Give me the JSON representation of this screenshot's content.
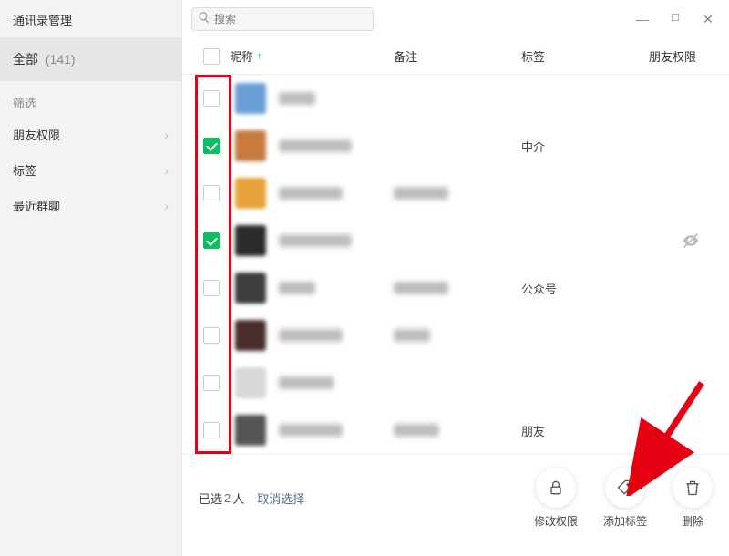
{
  "sidebar": {
    "title": "通讯录管理",
    "all_label": "全部",
    "all_count": "(141)",
    "filter_label": "筛选",
    "items": [
      {
        "label": "朋友权限"
      },
      {
        "label": "标签"
      },
      {
        "label": "最近群聊"
      }
    ]
  },
  "search": {
    "placeholder": "搜索"
  },
  "columns": {
    "nickname": "昵称",
    "remark": "备注",
    "tag": "标签",
    "permission": "朋友权限"
  },
  "rows": [
    {
      "checked": false,
      "avatar_color": "#6aa0d8",
      "nick_w": 40,
      "remark_w": 0,
      "tag": "",
      "perm_icon": false
    },
    {
      "checked": true,
      "avatar_color": "#c97a3f",
      "nick_w": 80,
      "remark_w": 0,
      "tag": "中介",
      "perm_icon": false
    },
    {
      "checked": false,
      "avatar_color": "#e8a23a",
      "nick_w": 70,
      "remark_w": 60,
      "tag": "",
      "perm_icon": false
    },
    {
      "checked": true,
      "avatar_color": "#2b2b2b",
      "nick_w": 80,
      "remark_w": 0,
      "tag": "",
      "perm_icon": true
    },
    {
      "checked": false,
      "avatar_color": "#3d3d3d",
      "nick_w": 40,
      "remark_w": 60,
      "tag": "公众号",
      "perm_icon": false
    },
    {
      "checked": false,
      "avatar_color": "#4a2d2d",
      "nick_w": 70,
      "remark_w": 40,
      "tag": "",
      "perm_icon": false
    },
    {
      "checked": false,
      "avatar_color": "#d8d8d8",
      "nick_w": 60,
      "remark_w": 0,
      "tag": "",
      "perm_icon": false
    },
    {
      "checked": false,
      "avatar_color": "#555555",
      "nick_w": 70,
      "remark_w": 50,
      "tag": "朋友",
      "perm_icon": false
    }
  ],
  "footer": {
    "selected_prefix": "已选",
    "selected_count": "2",
    "selected_suffix": "人",
    "deselect": "取消选择",
    "actions": [
      {
        "key": "perm",
        "label": "修改权限"
      },
      {
        "key": "tag",
        "label": "添加标签"
      },
      {
        "key": "del",
        "label": "删除"
      }
    ]
  }
}
